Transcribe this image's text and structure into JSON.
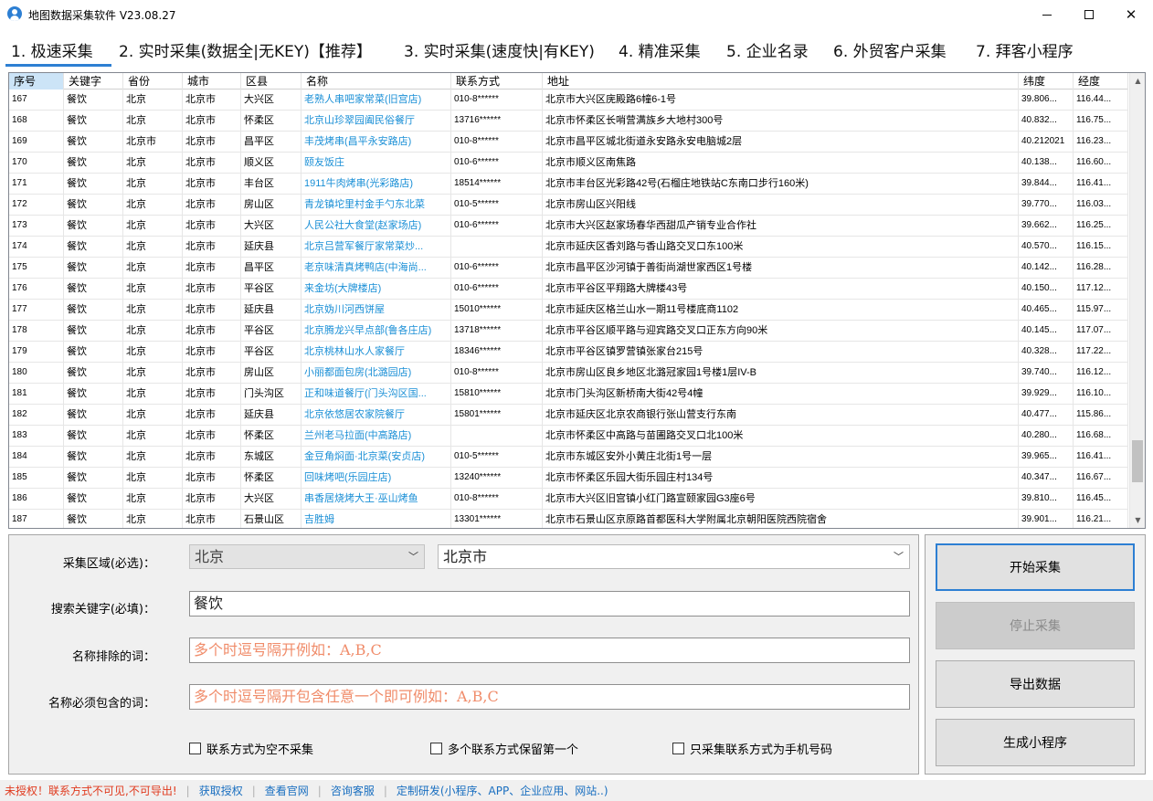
{
  "window": {
    "title": "地图数据采集软件 V23.08.27"
  },
  "tabs": [
    {
      "label": "1. 极速采集",
      "active": true
    },
    {
      "label": "2. 实时采集(数据全|无KEY)【推荐】"
    },
    {
      "label": "3. 实时采集(速度快|有KEY)"
    },
    {
      "label": "4. 精准采集"
    },
    {
      "label": "5. 企业名录"
    },
    {
      "label": "6. 外贸客户采集"
    },
    {
      "label": "7. 拜客小程序"
    }
  ],
  "table": {
    "columns": [
      "序号",
      "关键字",
      "省份",
      "城市",
      "区县",
      "名称",
      "联系方式",
      "地址",
      "纬度",
      "经度"
    ],
    "rows": [
      [
        "167",
        "餐饮",
        "北京",
        "北京市",
        "大兴区",
        "老熟人串吧家常菜(旧宫店)",
        "010-8******",
        "北京市大兴区庑殿路6幢6-1号",
        "39.806...",
        "116.44..."
      ],
      [
        "168",
        "餐饮",
        "北京",
        "北京市",
        "怀柔区",
        "北京山珍翠园阖民俗餐厅",
        "13716******",
        "北京市怀柔区长哨营满族乡大地村300号",
        "40.832...",
        "116.75..."
      ],
      [
        "169",
        "餐饮",
        "北京市",
        "北京市",
        "昌平区",
        "丰茂烤串(昌平永安路店)",
        "010-8******",
        "北京市昌平区城北街道永安路永安电脑城2层",
        "40.212021",
        "116.23..."
      ],
      [
        "170",
        "餐饮",
        "北京",
        "北京市",
        "顺义区",
        "颐友饭庄",
        "010-6******",
        "北京市顺义区南焦路",
        "40.138...",
        "116.60..."
      ],
      [
        "171",
        "餐饮",
        "北京",
        "北京市",
        "丰台区",
        "1911牛肉烤串(光彩路店)",
        "18514******",
        "北京市丰台区光彩路42号(石榴庄地铁站C东南口步行160米)",
        "39.844...",
        "116.41..."
      ],
      [
        "172",
        "餐饮",
        "北京",
        "北京市",
        "房山区",
        "青龙镇坨里村金手勺东北菜",
        "010-5******",
        "北京市房山区兴阳线",
        "39.770...",
        "116.03..."
      ],
      [
        "173",
        "餐饮",
        "北京",
        "北京市",
        "大兴区",
        "人民公社大食堂(赵家场店)",
        "010-6******",
        "北京市大兴区赵家场春华西甜瓜产销专业合作社",
        "39.662...",
        "116.25..."
      ],
      [
        "174",
        "餐饮",
        "北京",
        "北京市",
        "延庆县",
        "北京吕营军餐厅家常菜炒...",
        "",
        "北京市延庆区香刘路与香山路交叉口东100米",
        "40.570...",
        "116.15..."
      ],
      [
        "175",
        "餐饮",
        "北京",
        "北京市",
        "昌平区",
        "老京味清真烤鸭店(中海尚...",
        "010-6******",
        "北京市昌平区沙河镇于善街尚湖世家西区1号楼",
        "40.142...",
        "116.28..."
      ],
      [
        "176",
        "餐饮",
        "北京",
        "北京市",
        "平谷区",
        "来金坊(大牌楼店)",
        "010-6******",
        "北京市平谷区平翔路大牌楼43号",
        "40.150...",
        "117.12..."
      ],
      [
        "177",
        "餐饮",
        "北京",
        "北京市",
        "延庆县",
        "北京妫川河西饼屋",
        "15010******",
        "北京市延庆区格兰山水一期11号楼底商1102",
        "40.465...",
        "115.97..."
      ],
      [
        "178",
        "餐饮",
        "北京",
        "北京市",
        "平谷区",
        "北京腾龙兴早点部(鲁各庄店)",
        "13718******",
        "北京市平谷区顺平路与迎宾路交叉口正东方向90米",
        "40.145...",
        "117.07..."
      ],
      [
        "179",
        "餐饮",
        "北京",
        "北京市",
        "平谷区",
        "北京桃林山水人家餐厅",
        "18346******",
        "北京市平谷区镇罗营镇张家台215号",
        "40.328...",
        "117.22..."
      ],
      [
        "180",
        "餐饮",
        "北京",
        "北京市",
        "房山区",
        "小丽都面包房(北潞园店)",
        "010-8******",
        "北京市房山区良乡地区北潞冠家园1号楼1层IV-B",
        "39.740...",
        "116.12..."
      ],
      [
        "181",
        "餐饮",
        "北京",
        "北京市",
        "门头沟区",
        "正和味道餐厅(门头沟区国...",
        "15810******",
        "北京市门头沟区新桥南大街42号4幢",
        "39.929...",
        "116.10..."
      ],
      [
        "182",
        "餐饮",
        "北京",
        "北京市",
        "延庆县",
        "北京依悠居农家院餐厅",
        "15801******",
        "北京市延庆区北京农商银行张山营支行东南",
        "40.477...",
        "115.86..."
      ],
      [
        "183",
        "餐饮",
        "北京",
        "北京市",
        "怀柔区",
        "兰州老马拉面(中高路店)",
        "",
        "北京市怀柔区中高路与苗圃路交叉口北100米",
        "40.280...",
        "116.68..."
      ],
      [
        "184",
        "餐饮",
        "北京",
        "北京市",
        "东城区",
        "金豆角焖面·北京菜(安贞店)",
        "010-5******",
        "北京市东城区安外小黄庄北街1号一层",
        "39.965...",
        "116.41..."
      ],
      [
        "185",
        "餐饮",
        "北京",
        "北京市",
        "怀柔区",
        "回味烤吧(乐园庄店)",
        "13240******",
        "北京市怀柔区乐园大街乐园庄村134号",
        "40.347...",
        "116.67..."
      ],
      [
        "186",
        "餐饮",
        "北京",
        "北京市",
        "大兴区",
        "串香居烧烤大王·巫山烤鱼",
        "010-8******",
        "北京市大兴区旧宫镇小红门路宣颐家园G3座6号",
        "39.810...",
        "116.45..."
      ],
      [
        "187",
        "餐饮",
        "北京",
        "北京市",
        "石景山区",
        "吉胜姆",
        "13301******",
        "北京市石景山区京原路首都医科大学附属北京朝阳医院西院宿舍",
        "39.901...",
        "116.21..."
      ]
    ]
  },
  "form": {
    "region_label": "采集区域(必选)：",
    "province_value": "北京",
    "city_value": "北京市",
    "keyword_label": "搜索关键字(必填)：",
    "keyword_value": "餐饮",
    "exclude_label": "名称排除的词：",
    "exclude_placeholder": "多个时逗号隔开例如：A,B,C",
    "include_label": "名称必须包含的词：",
    "include_placeholder": "多个时逗号隔开包含任意一个即可例如：A,B,C",
    "check_empty_contact": "联系方式为空不采集",
    "check_first_contact": "多个联系方式保留第一个",
    "check_mobile_only": "只采集联系方式为手机号码"
  },
  "buttons": {
    "start": "开始采集",
    "stop": "停止采集",
    "export": "导出数据",
    "miniprogram": "生成小程序"
  },
  "status": {
    "warning": "未授权！联系方式不可见,不可导出!",
    "get_license": "获取授权",
    "website": "查看官网",
    "support": "咨询客服",
    "custom_dev": "定制研发(小程序、APP、企业应用、网站..)"
  },
  "colors": {
    "accent": "#2d7fd3",
    "name_link": "#1a8fd6",
    "warning": "#e03a1e",
    "placeholder": "#f08c6a"
  }
}
